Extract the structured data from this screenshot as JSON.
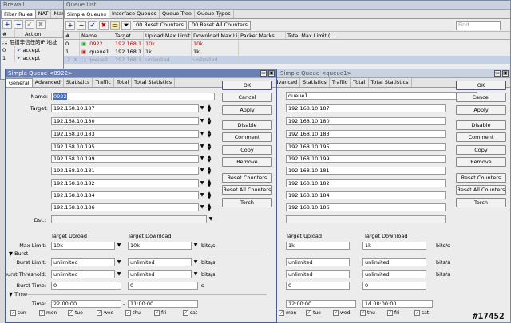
{
  "firewall": {
    "title": "Firewall",
    "tabs": [
      "Filter Rules",
      "NAT",
      "Man"
    ],
    "col_num": "#",
    "col_action": "Action",
    "comment": ";;; 阻擋非信任的IP 地址",
    "rows": [
      {
        "n": "0",
        "action": "accept"
      },
      {
        "n": "1",
        "action": "accept"
      }
    ]
  },
  "queue_list": {
    "title": "Queue List",
    "tabs": [
      "Simple Queues",
      "Interface Queues",
      "Queue Tree",
      "Queue Types"
    ],
    "toolbar": {
      "reset_counters": "Reset Counters",
      "reset_all": "Reset All Counters",
      "find": "Find"
    },
    "columns": [
      "#",
      "Name",
      "Target",
      "Upload Max Limit",
      "Download Max Li...",
      "Packet Marks",
      "Total Max Limit (..."
    ],
    "rows": [
      {
        "n": "0",
        "name": "0922",
        "target": "192.168.1...",
        "up": "10k",
        "down": "10k"
      },
      {
        "n": "1",
        "name": "queue1",
        "target": "192.168.1...",
        "up": "1k",
        "down": "1k"
      },
      {
        "n": "2",
        "flag": "X",
        "name": ";;; queue2",
        "target": "192.168.1...",
        "up": "unlimited",
        "down": "unlimited"
      }
    ]
  },
  "dlg1": {
    "title": "Simple Queue <0922>",
    "tabs": [
      "General",
      "Advanced",
      "Statistics",
      "Traffic",
      "Total",
      "Total Statistics"
    ],
    "name_label": "Name:",
    "name": "0922",
    "target_label": "Target:",
    "targets": [
      "192.168.10.187",
      "192.168.10.180",
      "192.168.10.183",
      "192.168.10.195",
      "192.168.10.199",
      "192.168.10.181",
      "192.168.10.182",
      "192.168.10.184",
      "192.168.10.186"
    ],
    "dst_label": "Dst.:",
    "target_upload": "Target Upload",
    "target_download": "Target Download",
    "max_limit_label": "Max Limit:",
    "max_up": "10k",
    "max_down": "10k",
    "unit": "bits/s",
    "burst": "Burst",
    "burst_limit_label": "Burst Limit:",
    "burst_threshold_label": "Burst Threshold:",
    "burst_time_label": "Burst Time:",
    "unlimited": "unlimited",
    "zero": "0",
    "s": "s",
    "time_section": "Time",
    "time_label": "Time:",
    "time_from": "22:00:00",
    "time_to": "11:00:00",
    "days": [
      "sun",
      "mon",
      "tue",
      "wed",
      "thu",
      "fri",
      "sat"
    ]
  },
  "dlg2": {
    "title": "Simple Queue <queue1>",
    "tabs": [
      "Advanced",
      "Statistics",
      "Traffic",
      "Total",
      "Total Statistics"
    ],
    "name": "queue1",
    "max_up": "1k",
    "max_down": "1k",
    "time_from": "12:00:00",
    "time_to": "1d 00:00:00",
    "days": [
      "mon",
      "tue",
      "wed",
      "thu",
      "fri",
      "sat"
    ]
  },
  "buttons": [
    "OK",
    "Cancel",
    "Apply",
    "Disable",
    "Comment",
    "Copy",
    "Remove",
    "Reset Counters",
    "Reset All Counters",
    "Torch"
  ],
  "watermark": "#17452"
}
